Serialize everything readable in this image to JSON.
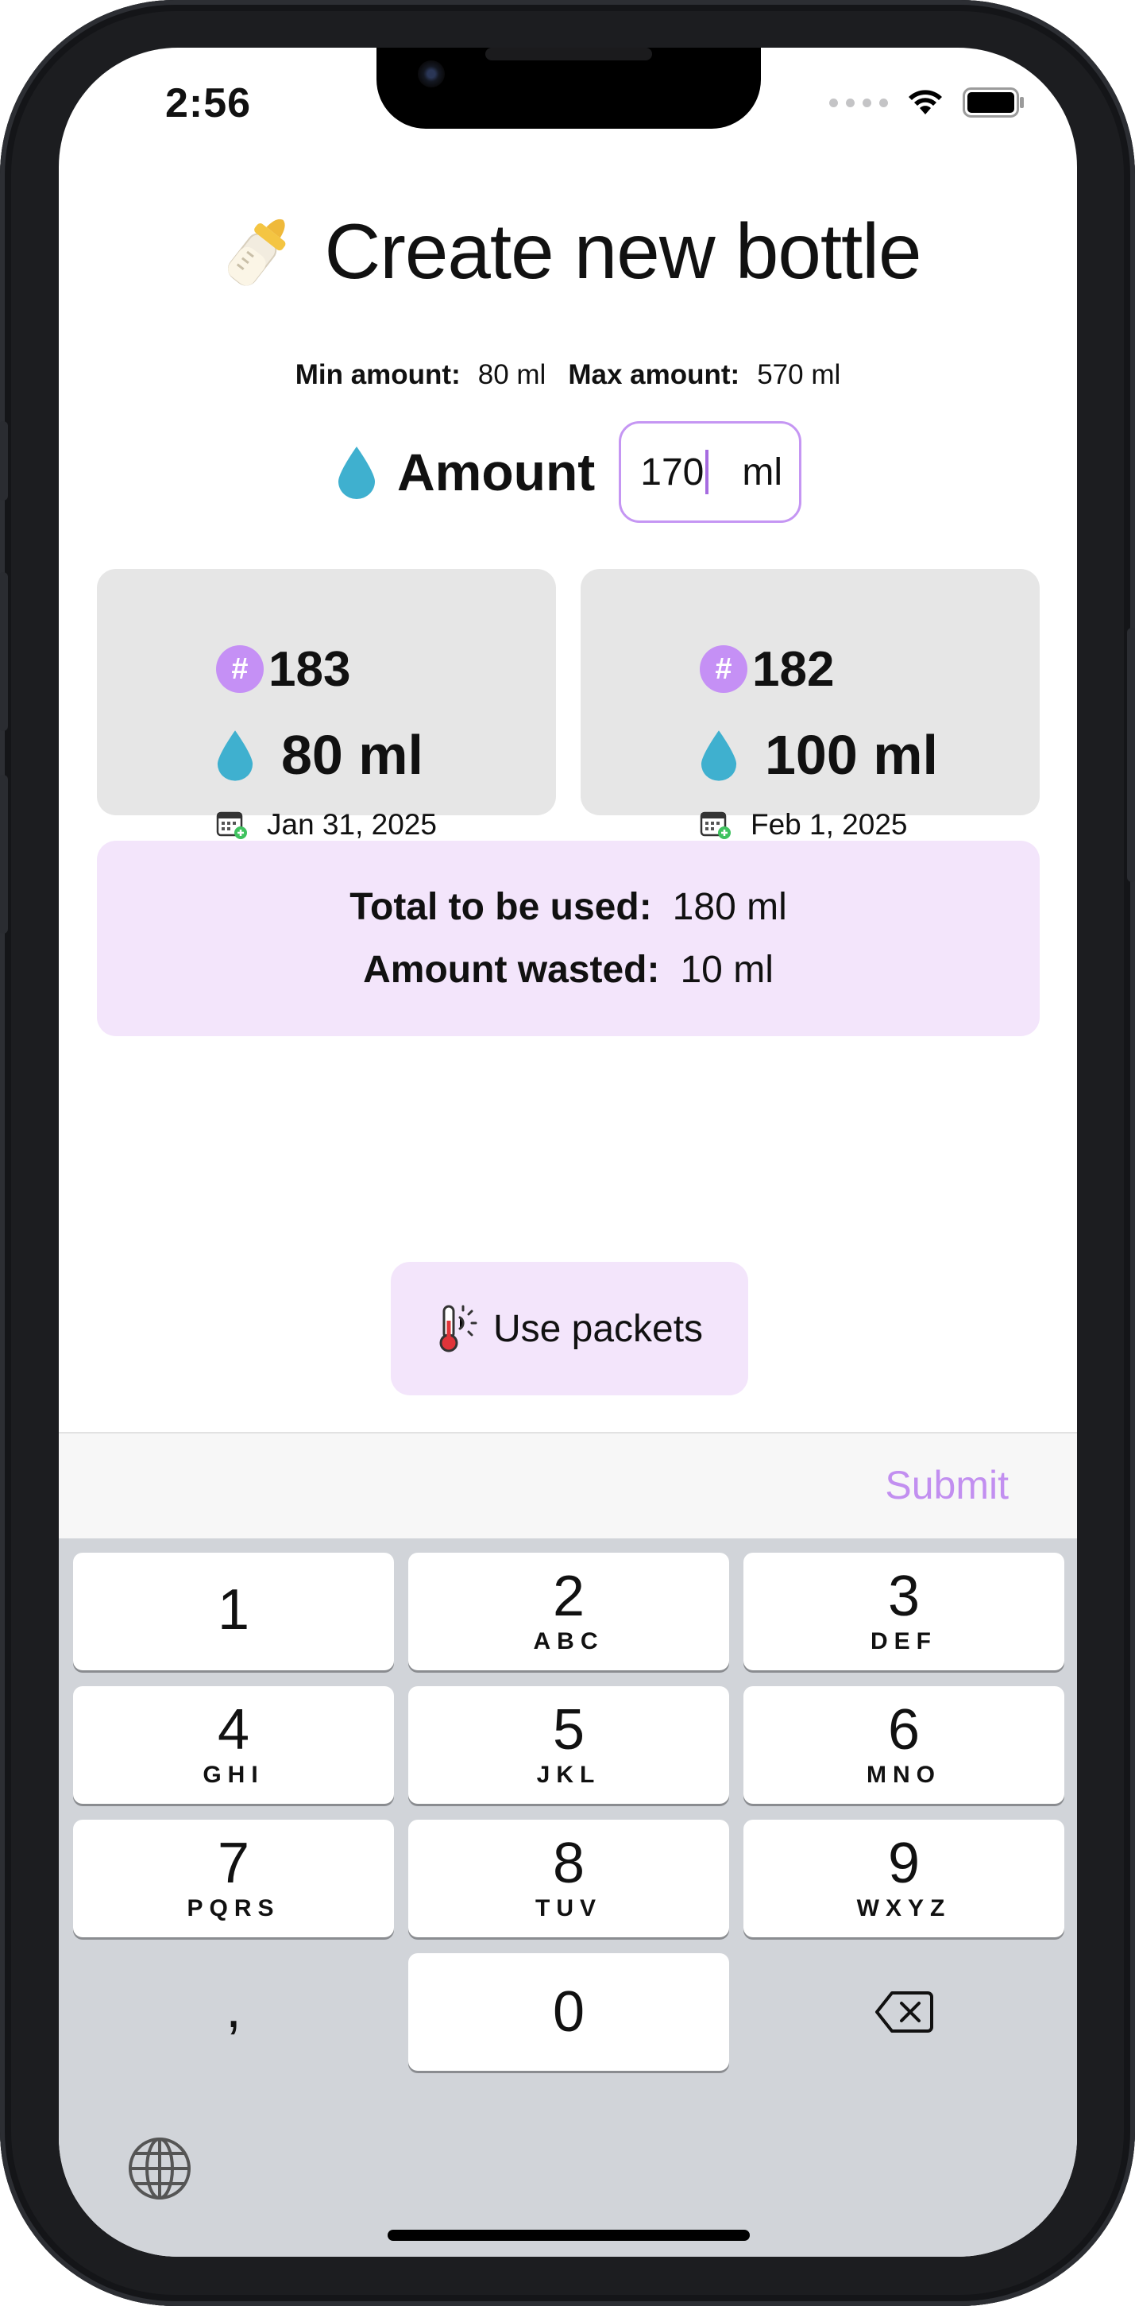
{
  "status": {
    "time": "2:56"
  },
  "page": {
    "title": "Create new bottle",
    "min_label": "Min amount:",
    "min_value": "80 ml",
    "max_label": "Max amount:",
    "max_value": "570 ml"
  },
  "amount": {
    "label": "Amount",
    "value": "170",
    "unit": "ml"
  },
  "packets": [
    {
      "id": "183",
      "amount": "80 ml",
      "date": "Jan 31, 2025"
    },
    {
      "id": "182",
      "amount": "100 ml",
      "date": "Feb 1, 2025"
    }
  ],
  "summary": {
    "total_label": "Total to be used:",
    "total_value": "180 ml",
    "wasted_label": "Amount wasted:",
    "wasted_value": "10 ml"
  },
  "use_packets_button": {
    "label": "Use packets"
  },
  "keyboard": {
    "submit_label": "Submit",
    "keys": [
      {
        "num": "1",
        "letters": ""
      },
      {
        "num": "2",
        "letters": "ABC"
      },
      {
        "num": "3",
        "letters": "DEF"
      },
      {
        "num": "4",
        "letters": "GHI"
      },
      {
        "num": "5",
        "letters": "JKL"
      },
      {
        "num": "6",
        "letters": "MNO"
      },
      {
        "num": "7",
        "letters": "PQRS"
      },
      {
        "num": "8",
        "letters": "TUV"
      },
      {
        "num": "9",
        "letters": "WXYZ"
      },
      {
        "num": "0",
        "letters": ""
      }
    ],
    "comma": ","
  },
  "colors": {
    "accent": "#c28ff0",
    "drop": "#3fb0cf",
    "card": "#e6e6e6",
    "highlight": "#f3e5fb"
  },
  "icons": [
    "baby-bottle-icon",
    "water-drop-icon",
    "hash-badge-icon",
    "calendar-add-icon",
    "thermometer-icon",
    "backspace-icon",
    "globe-icon",
    "wifi-icon",
    "battery-icon"
  ]
}
